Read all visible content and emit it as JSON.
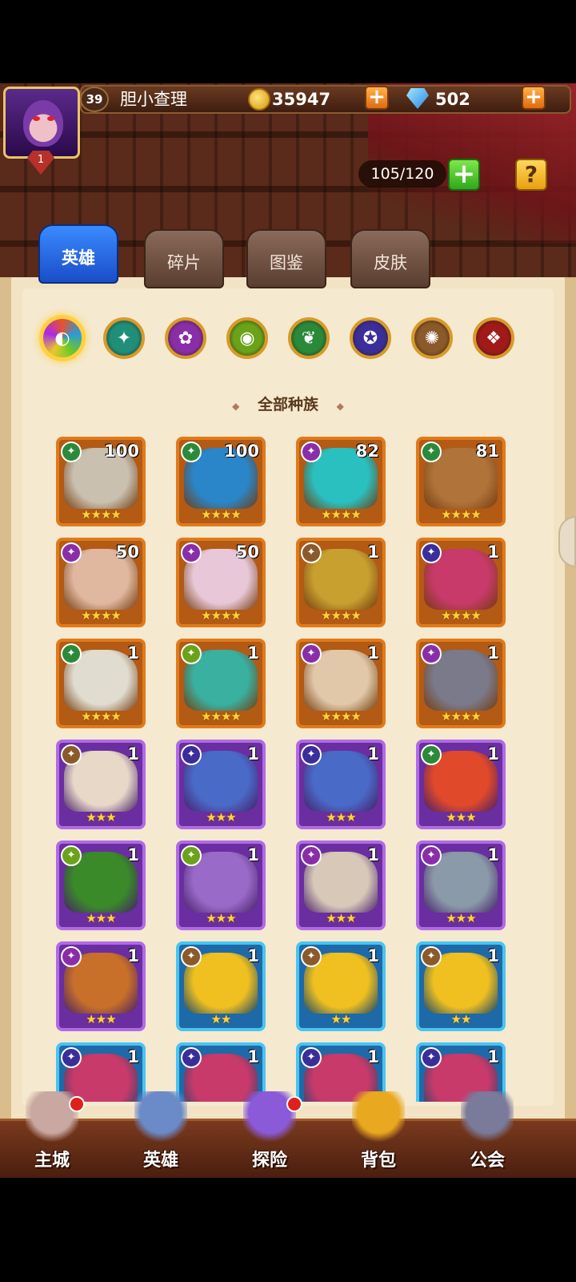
{
  "player": {
    "level": "39",
    "name": "胆小查理",
    "vip": "1"
  },
  "currency": {
    "gold": "35947",
    "gems": "502",
    "plus": "+"
  },
  "capacity": {
    "value": "105/120",
    "plus": "+",
    "help": "?"
  },
  "tabs": [
    {
      "label": "英雄",
      "active": true
    },
    {
      "label": "碎片",
      "active": false
    },
    {
      "label": "图鉴",
      "active": false
    },
    {
      "label": "皮肤",
      "active": false
    }
  ],
  "race_filters": [
    {
      "name": "all-races",
      "color": "#e8532a",
      "glyph": "◐"
    },
    {
      "name": "race-1",
      "color": "#1f8f7a",
      "glyph": "✦"
    },
    {
      "name": "race-2",
      "color": "#8a2ea8",
      "glyph": "✿"
    },
    {
      "name": "race-3",
      "color": "#6aa21a",
      "glyph": "◉"
    },
    {
      "name": "race-4",
      "color": "#2a8a3a",
      "glyph": "❦"
    },
    {
      "name": "race-5",
      "color": "#3a2e9a",
      "glyph": "✪"
    },
    {
      "name": "race-6",
      "color": "#8a5a2a",
      "glyph": "✺"
    },
    {
      "name": "race-7",
      "color": "#a01a1a",
      "glyph": "❖"
    }
  ],
  "filter_title": "全部种族",
  "heroes": [
    {
      "count": "100",
      "stars": "★★★★",
      "frame": "orange",
      "race": "#2a8a3a",
      "tint": "#c9c0b0"
    },
    {
      "count": "100",
      "stars": "★★★★",
      "frame": "orange",
      "race": "#2a8a3a",
      "tint": "#2a86c8"
    },
    {
      "count": "82",
      "stars": "★★★★",
      "frame": "orange",
      "race": "#8a2ea8",
      "tint": "#2ac0c0"
    },
    {
      "count": "81",
      "stars": "★★★★",
      "frame": "orange",
      "race": "#2a8a3a",
      "tint": "#b0743a"
    },
    {
      "count": "50",
      "stars": "★★★★",
      "frame": "orange",
      "race": "#8a2ea8",
      "tint": "#e0b8a0"
    },
    {
      "count": "50",
      "stars": "★★★★",
      "frame": "orange",
      "race": "#8a2ea8",
      "tint": "#e8c8d8"
    },
    {
      "count": "1",
      "stars": "★★★★",
      "frame": "orange",
      "race": "#8a5a2a",
      "tint": "#c8a030"
    },
    {
      "count": "1",
      "stars": "★★★★",
      "frame": "orange",
      "race": "#3a2e9a",
      "tint": "#c83a6a"
    },
    {
      "count": "1",
      "stars": "★★★★",
      "frame": "orange",
      "race": "#2a8a3a",
      "tint": "#e0dcd0"
    },
    {
      "count": "1",
      "stars": "★★★★",
      "frame": "orange",
      "race": "#6aa21a",
      "tint": "#3ab0a0"
    },
    {
      "count": "1",
      "stars": "★★★★",
      "frame": "orange",
      "race": "#8a2ea8",
      "tint": "#e0c8a8"
    },
    {
      "count": "1",
      "stars": "★★★★",
      "frame": "orange",
      "race": "#8a2ea8",
      "tint": "#7a7a8a"
    },
    {
      "count": "1",
      "stars": "★★★",
      "frame": "purple",
      "race": "#8a5a2a",
      "tint": "#e8d8c8"
    },
    {
      "count": "1",
      "stars": "★★★",
      "frame": "purple",
      "race": "#3a2e9a",
      "tint": "#4a6ac8"
    },
    {
      "count": "1",
      "stars": "★★★",
      "frame": "purple",
      "race": "#3a2e9a",
      "tint": "#4a6ac8"
    },
    {
      "count": "1",
      "stars": "★★★",
      "frame": "purple",
      "race": "#2a8a3a",
      "tint": "#e04a2a"
    },
    {
      "count": "1",
      "stars": "★★★",
      "frame": "purple",
      "race": "#6aa21a",
      "tint": "#3a8a2a"
    },
    {
      "count": "1",
      "stars": "★★★",
      "frame": "purple",
      "race": "#6aa21a",
      "tint": "#9a6ac8"
    },
    {
      "count": "1",
      "stars": "★★★",
      "frame": "purple",
      "race": "#8a2ea8",
      "tint": "#d8c8b8"
    },
    {
      "count": "1",
      "stars": "★★★",
      "frame": "purple",
      "race": "#8a2ea8",
      "tint": "#8a9aa8"
    },
    {
      "count": "1",
      "stars": "★★★",
      "frame": "purple",
      "race": "#8a2ea8",
      "tint": "#c8702a"
    },
    {
      "count": "1",
      "stars": "★★",
      "frame": "blue",
      "race": "#8a5a2a",
      "tint": "#f0c020"
    },
    {
      "count": "1",
      "stars": "★★",
      "frame": "blue",
      "race": "#8a5a2a",
      "tint": "#f0c020"
    },
    {
      "count": "1",
      "stars": "★★",
      "frame": "blue",
      "race": "#8a5a2a",
      "tint": "#f0c020"
    },
    {
      "count": "1",
      "stars": "★★",
      "frame": "blue",
      "race": "#3a2e9a",
      "tint": "#c83a6a"
    },
    {
      "count": "1",
      "stars": "★★",
      "frame": "blue",
      "race": "#3a2e9a",
      "tint": "#c83a6a"
    },
    {
      "count": "1",
      "stars": "★★",
      "frame": "blue",
      "race": "#3a2e9a",
      "tint": "#c83a6a"
    },
    {
      "count": "1",
      "stars": "★★",
      "frame": "blue",
      "race": "#3a2e9a",
      "tint": "#c83a6a"
    }
  ],
  "nav": [
    {
      "label": "主城",
      "icon": "castle-icon",
      "color": "#c8a8a0",
      "badge": true
    },
    {
      "label": "英雄",
      "icon": "hero-icon",
      "color": "#6a8ac8",
      "badge": false
    },
    {
      "label": "探险",
      "icon": "portal-icon",
      "color": "#8a5ad8",
      "badge": true
    },
    {
      "label": "背包",
      "icon": "backpack-icon",
      "color": "#e8a820",
      "badge": false
    },
    {
      "label": "公会",
      "icon": "guild-icon",
      "color": "#7a7a9a",
      "badge": false
    }
  ]
}
